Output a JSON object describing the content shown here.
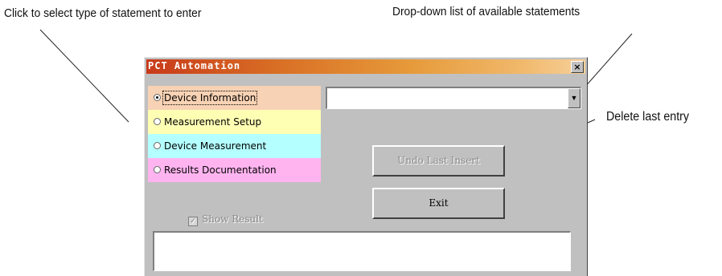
{
  "callouts": {
    "select_type": "Click to select type of statement to enter",
    "dropdown": "Drop-down list of available statements",
    "delete_last": "Delete last entry"
  },
  "window": {
    "title": "PCT Automation",
    "close_glyph": "×"
  },
  "statement_types": [
    {
      "label": "Device Information",
      "color": "#f8d2b4",
      "selected": true
    },
    {
      "label": "Measurement Setup",
      "color": "#ffffb4",
      "selected": false
    },
    {
      "label": "Device Measurement",
      "color": "#b4ffff",
      "selected": false
    },
    {
      "label": "Results Documentation",
      "color": "#ffb4f0",
      "selected": false
    }
  ],
  "statement_dropdown": {
    "value": "",
    "arrow_glyph": "▼"
  },
  "buttons": {
    "undo": "Undo Last Insert",
    "exit": "Exit"
  },
  "show_results": {
    "label": "Show Result",
    "checked": true,
    "check_glyph": "✓"
  },
  "results_box": {
    "value": ""
  }
}
